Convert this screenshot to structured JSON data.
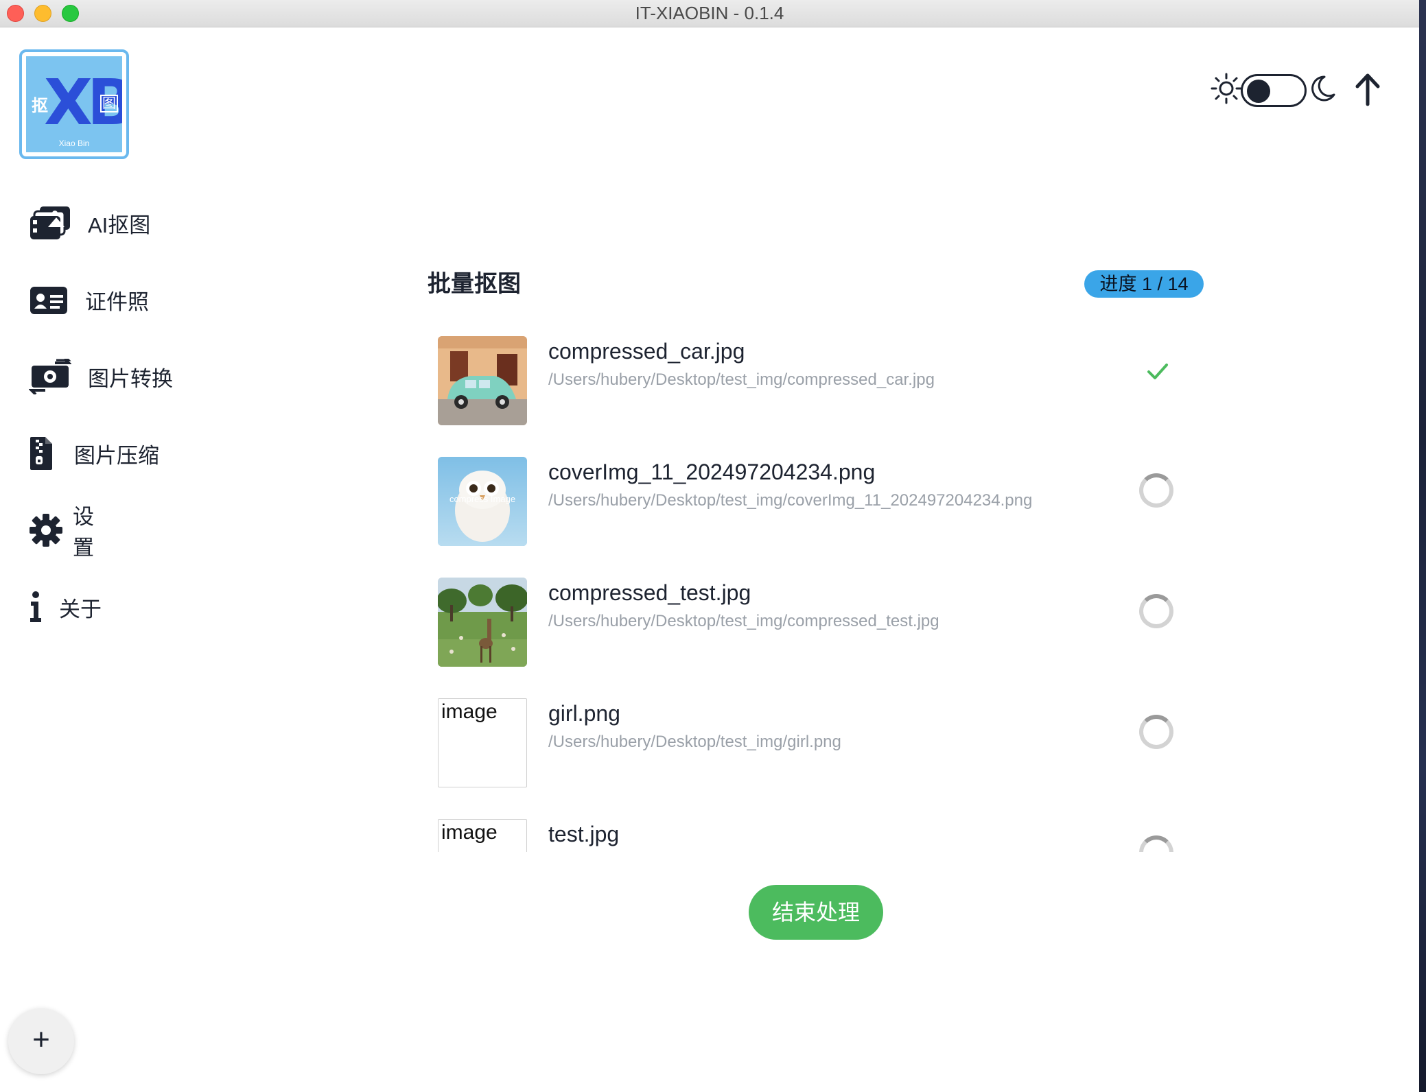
{
  "window": {
    "title": "IT-XIAOBIN - 0.1.4"
  },
  "logo": {
    "left_char": "抠",
    "main": "XB",
    "right_char": "图",
    "sub": "Xiao Bin"
  },
  "sidebar": {
    "items": [
      {
        "label": "AI抠图",
        "icon": "images-icon"
      },
      {
        "label": "证件照",
        "icon": "id-card-icon"
      },
      {
        "label": "图片转换",
        "icon": "money-convert-icon"
      },
      {
        "label": "图片压缩",
        "icon": "zip-file-icon"
      },
      {
        "label": "设置",
        "icon": "gear-icon"
      },
      {
        "label": "关于",
        "icon": "info-icon"
      }
    ]
  },
  "theme": {
    "mode": "light"
  },
  "main": {
    "title": "批量抠图",
    "progress": "进度 1 / 14",
    "files": [
      {
        "name": "compressed_car.jpg",
        "path": "/Users/hubery/Desktop/test_img/compressed_car.jpg",
        "status": "done",
        "thumb": "car-photo"
      },
      {
        "name": "coverImg_11_202497204234.png",
        "path": "/Users/hubery/Desktop/test_img/coverImg_11_202497204234.png",
        "status": "loading",
        "thumb": "owl-photo",
        "thumb_text": "compress Image"
      },
      {
        "name": "compressed_test.jpg",
        "path": "/Users/hubery/Desktop/test_img/compressed_test.jpg",
        "status": "loading",
        "thumb": "giraffe-photo"
      },
      {
        "name": "girl.png",
        "path": "/Users/hubery/Desktop/test_img/girl.png",
        "status": "loading",
        "thumb": "broken",
        "thumb_alt": "image"
      },
      {
        "name": "test.jpg",
        "path": "",
        "status": "loading",
        "thumb": "broken",
        "thumb_alt": "image"
      }
    ],
    "finish_button": "结束处理"
  },
  "fab": {
    "label": "+"
  },
  "colors": {
    "accent_green": "#4cbb5e",
    "badge_blue": "#3aa5e8",
    "text_dark": "#1d2330",
    "path_gray": "#9aa0a8"
  }
}
